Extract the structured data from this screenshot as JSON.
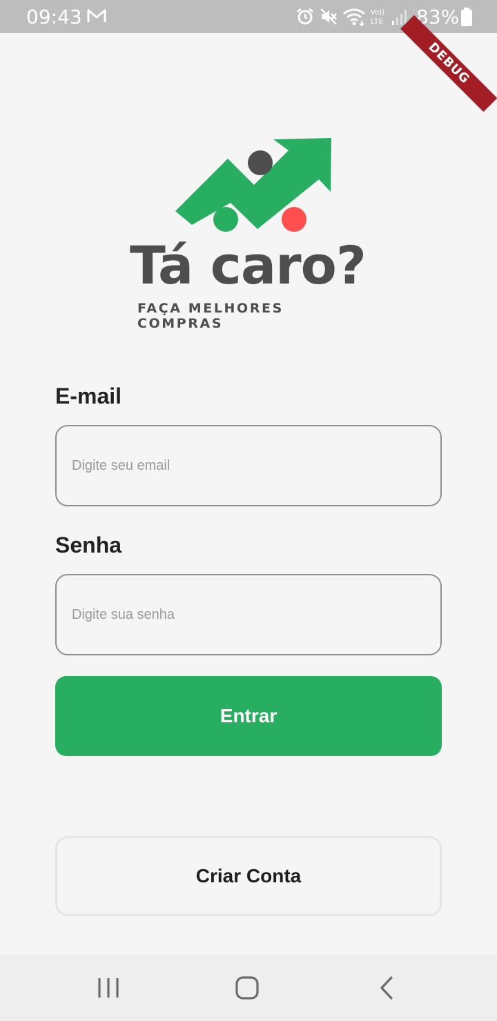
{
  "status_bar": {
    "time": "09:43",
    "battery": "83%",
    "icons": [
      "mail-icon",
      "alarm-icon",
      "mute-icon",
      "wifi-icon",
      "volte-icon",
      "signal-icon",
      "battery-icon"
    ],
    "volte_label": "Vo)) LTE"
  },
  "debug_banner": "DEBUG",
  "logo": {
    "title": "Tá caro?",
    "tagline": "FAÇA MELHORES COMPRAS",
    "colors": {
      "green": "#27ae60",
      "gray": "#4f4e4f",
      "red": "#ff4f4f"
    }
  },
  "form": {
    "email_label": "E-mail",
    "email_placeholder": "Digite seu email",
    "email_value": "",
    "password_label": "Senha",
    "password_placeholder": "Digite sua senha",
    "password_value": "",
    "login_button": "Entrar",
    "signup_button": "Criar Conta"
  },
  "nav_bar": {
    "buttons": [
      "recent-apps-icon",
      "home-icon",
      "back-icon"
    ]
  },
  "colors": {
    "primary": "#28ae61",
    "background": "#f5f5f5",
    "text": "#222222"
  }
}
